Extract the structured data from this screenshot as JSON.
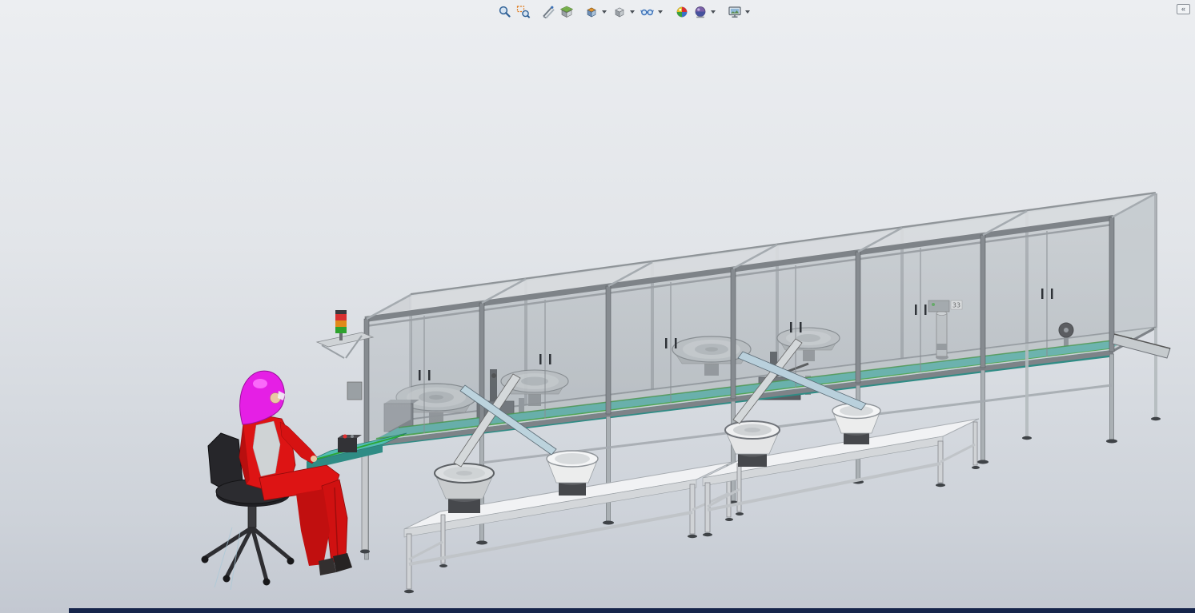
{
  "toolbar": {
    "buttons": [
      {
        "name": "zoom-to-fit",
        "icon": "magnifier-icon",
        "has_dropdown": false
      },
      {
        "name": "zoom-to-area",
        "icon": "magnifier-area-icon",
        "has_dropdown": false
      },
      {
        "name": "measure",
        "icon": "caliper-icon",
        "has_dropdown": false
      },
      {
        "name": "section-view",
        "icon": "section-cube-icon",
        "has_dropdown": false
      },
      {
        "name": "view-orientation",
        "icon": "view-cube-icon",
        "has_dropdown": true
      },
      {
        "name": "display-style",
        "icon": "shaded-cube-icon",
        "has_dropdown": true
      },
      {
        "name": "hide-show-items",
        "icon": "glasses-icon",
        "has_dropdown": true
      },
      {
        "name": "edit-appearance",
        "icon": "color-sphere-icon",
        "has_dropdown": false
      },
      {
        "name": "apply-scene",
        "icon": "scene-sphere-icon",
        "has_dropdown": true
      },
      {
        "name": "view-settings",
        "icon": "monitor-icon",
        "has_dropdown": true
      }
    ]
  },
  "window_controls": {
    "collapse_glyph": "«",
    "collapse_name": "collapse-panel"
  },
  "scene": {
    "tag_label": "33",
    "objects": [
      "safety-enclosure",
      "conveyor-belt",
      "bowl-feeder-inside-1",
      "bowl-feeder-inside-2",
      "bowl-feeder-inside-3",
      "bowl-feeder-inside-4",
      "bowl-feeder-front-1",
      "bowl-feeder-front-2",
      "bowl-feeder-front-3",
      "bowl-feeder-front-4",
      "support-table-left",
      "support-table-right",
      "operator",
      "operator-chair",
      "operator-bench",
      "signal-tower",
      "discharge-chute",
      "belt-pulley"
    ],
    "colors": {
      "conveyor_teal": "#4ab3a9",
      "bench_teal": "#52bdb3",
      "belt_edge_green": "#27a327",
      "glass_gray": "#b6bcc0",
      "frame_gray": "#7e8388",
      "table_white": "#f1f2f4",
      "suit_red": "#dd1414",
      "helmet_magenta": "#e51fe5",
      "chair_black": "#2c2c30",
      "signal_red": "#d83030",
      "signal_amber": "#e08a1a",
      "signal_green": "#2ea22e",
      "taskbar_navy": "#15244a"
    }
  }
}
